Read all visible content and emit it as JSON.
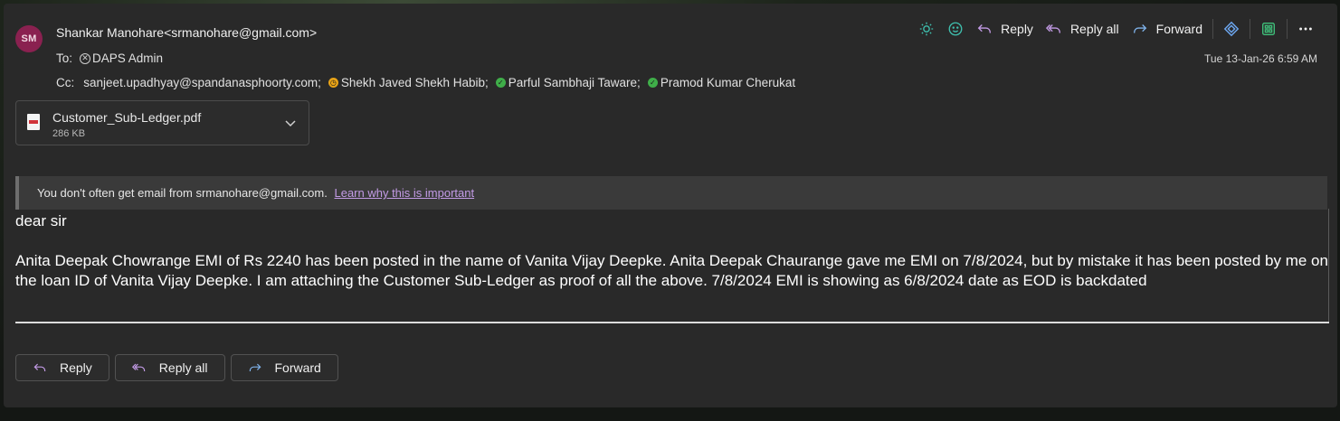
{
  "sender": {
    "initials": "SM",
    "display": "Shankar Manohare<srmanohare@gmail.com>"
  },
  "to": {
    "label": "To:",
    "recipient": "DAPS Admin"
  },
  "cc": {
    "label": "Cc:",
    "recipients": [
      {
        "name": "sanjeet.upadhyay@spandanasphoorty.com;",
        "status": "none"
      },
      {
        "name": "Shekh Javed Shekh Habib;",
        "status": "away"
      },
      {
        "name": "Parful Sambhaji Taware;",
        "status": "available"
      },
      {
        "name": "Pramod Kumar Cherukat",
        "status": "available"
      }
    ]
  },
  "toolbar": {
    "reply": "Reply",
    "reply_all": "Reply all",
    "forward": "Forward"
  },
  "date": "Tue 13-Jan-26 6:59 AM",
  "attachment": {
    "filename": "Customer_Sub-Ledger.pdf",
    "size": "286 KB"
  },
  "warning": {
    "text": "You don't often get email from srmanohare@gmail.com.",
    "link": "Learn why this is important"
  },
  "body": {
    "greeting": "dear sir",
    "paragraph": "Anita Deepak Chowrange EMI of Rs 2240 has been posted in the name of Vanita Vijay Deepke. Anita Deepak Chaurange gave me EMI on 7/8/2024, but by mistake it has been posted by me on the loan ID of Vanita Vijay Deepke. I am attaching the Customer Sub-Ledger  as proof of all the above. 7/8/2024 EMI is showing as 6/8/2024 date as EOD is backdated"
  },
  "actions": {
    "reply": "Reply",
    "reply_all": "Reply all",
    "forward": "Forward"
  },
  "colors": {
    "avatar": "#8a2150",
    "accent_teal": "#3fbfae",
    "reply_icon": "#c39be6",
    "forward_icon": "#7fb2ea"
  }
}
